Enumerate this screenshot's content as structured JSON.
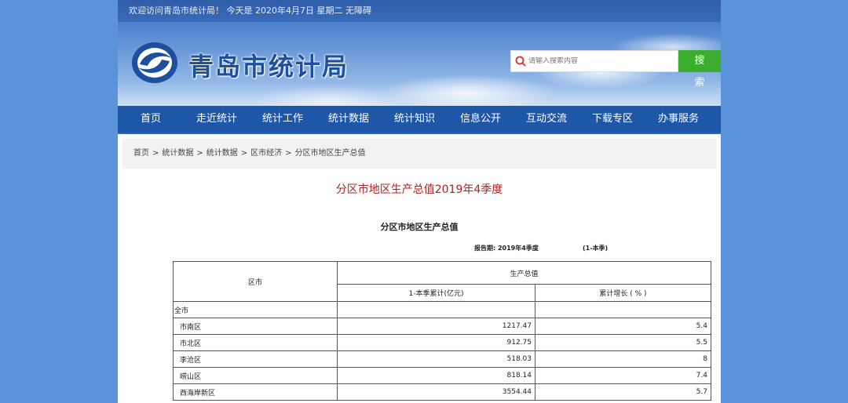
{
  "header": {
    "welcome_text": "欢迎访问青岛市统计局！ 今天是 2020年4月7日 星期二    无障碍",
    "site_title": "青岛市统计局",
    "search_placeholder": "请输入搜索内容",
    "search_button": "搜 索"
  },
  "nav": {
    "items": [
      "首页",
      "走近统计",
      "统计工作",
      "统计数据",
      "统计知识",
      "信息公开",
      "互动交流",
      "下载专区",
      "办事服务"
    ]
  },
  "breadcrumb": [
    "首页",
    "统计数据",
    "统计数据",
    "区市经济",
    "分区市地区生产总值"
  ],
  "article": {
    "title": "分区市地区生产总值2019年4季度",
    "table_title": "分区市地区生产总值",
    "report_period": "报告期: 2019年4季度",
    "report_range": "(1-本季)"
  },
  "table": {
    "col_region": "区市",
    "col_gdp": "生产总值",
    "col_cumulative": "1-本季累计(亿元)",
    "col_growth": "累计增长 ( % )",
    "rows": [
      {
        "name": "全市",
        "value": "",
        "growth": ""
      },
      {
        "name": "市南区",
        "value": "1217.47",
        "growth": "5.4"
      },
      {
        "name": "市北区",
        "value": "912.75",
        "growth": "5.5"
      },
      {
        "name": "李沧区",
        "value": "518.03",
        "growth": "8"
      },
      {
        "name": "崂山区",
        "value": "818.14",
        "growth": "7.4"
      },
      {
        "name": "西海岸新区",
        "value": "3554.44",
        "growth": "5.7"
      }
    ]
  },
  "colors": {
    "nav_bg": "#1f57a8",
    "title_red": "#b22020",
    "search_green": "#3cae2f"
  }
}
